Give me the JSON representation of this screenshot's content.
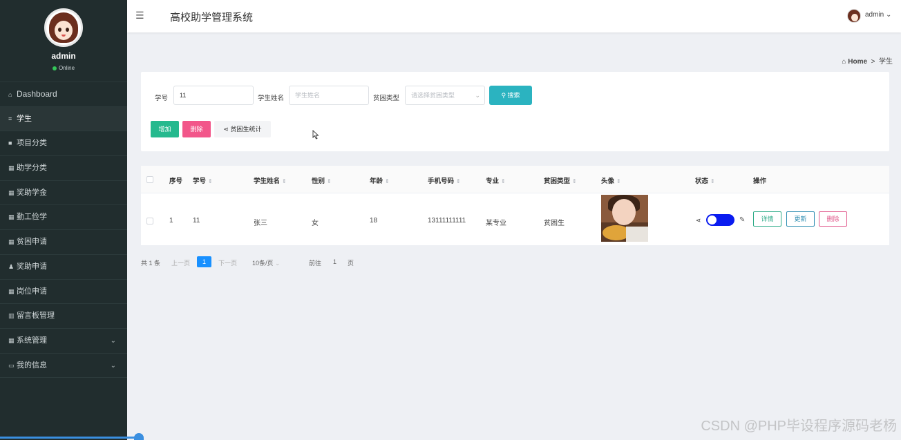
{
  "sidebar": {
    "profile_name": "admin",
    "profile_status": "Online",
    "items": [
      {
        "icon": "home-icon",
        "glyph": "⌂",
        "label": "Dashboard"
      },
      {
        "icon": "list-icon",
        "glyph": "≡",
        "label": "学生"
      },
      {
        "icon": "tag-icon",
        "glyph": "■",
        "label": "项目分类"
      },
      {
        "icon": "grid-icon",
        "glyph": "▦",
        "label": "助学分类"
      },
      {
        "icon": "grid-icon",
        "glyph": "▦",
        "label": "奖助学金"
      },
      {
        "icon": "table-icon",
        "glyph": "▦",
        "label": "勤工俭学"
      },
      {
        "icon": "grid-icon",
        "glyph": "▦",
        "label": "贫困申请"
      },
      {
        "icon": "user-icon",
        "glyph": "♟",
        "label": "奖助申请"
      },
      {
        "icon": "grid-icon",
        "glyph": "▦",
        "label": "岗位申请"
      },
      {
        "icon": "bar-chart-icon",
        "glyph": "▥",
        "label": "留言板管理"
      },
      {
        "icon": "grid-icon",
        "glyph": "▦",
        "label": "系统管理"
      },
      {
        "icon": "card-icon",
        "glyph": "▭",
        "label": "我的信息"
      }
    ],
    "active_index": 1
  },
  "header": {
    "title": "高校助学管理系统",
    "user": "admin",
    "menu_glyph": "☰"
  },
  "breadcrumb": {
    "home": "Home",
    "separator": ">",
    "current": "学生"
  },
  "search": {
    "student_no_label": "学号",
    "student_no_value": "11",
    "name_label": "学生姓名",
    "name_placeholder": "学生姓名",
    "poverty_label": "贫困类型",
    "poverty_placeholder": "请选择贫困类型",
    "search_button": "搜索"
  },
  "actions": {
    "add": "增加",
    "delete": "删除",
    "stats": "贫困生统计"
  },
  "table": {
    "columns": [
      "序号",
      "学号",
      "学生姓名",
      "性别",
      "年龄",
      "手机号码",
      "专业",
      "贫困类型",
      "头像",
      "状态",
      "操作"
    ],
    "rows": [
      {
        "index": "1",
        "student_no": "11",
        "name": "张三",
        "gender": "女",
        "age": "18",
        "phone": "13111111111",
        "major": "某专业",
        "poverty_type": "贫困生",
        "status_on": true
      }
    ],
    "op_detail": "详情",
    "op_update": "更新",
    "op_delete": "删除"
  },
  "pagination": {
    "total": "共 1 条",
    "prev": "上一页",
    "current": "1",
    "next": "下一页",
    "page_size": "10条/页",
    "goto_label": "前往",
    "goto_value": "1",
    "page_unit": "页"
  },
  "watermark": "CSDN @PHP毕设程序源码老杨",
  "colors": {
    "sidebar_bg": "#212d2e",
    "search_button": "#2bb3c0",
    "add_button": "#25b98e",
    "delete_button": "#f2568a",
    "toggle_on": "#0a1cf0",
    "page_current": "#1890ff"
  }
}
